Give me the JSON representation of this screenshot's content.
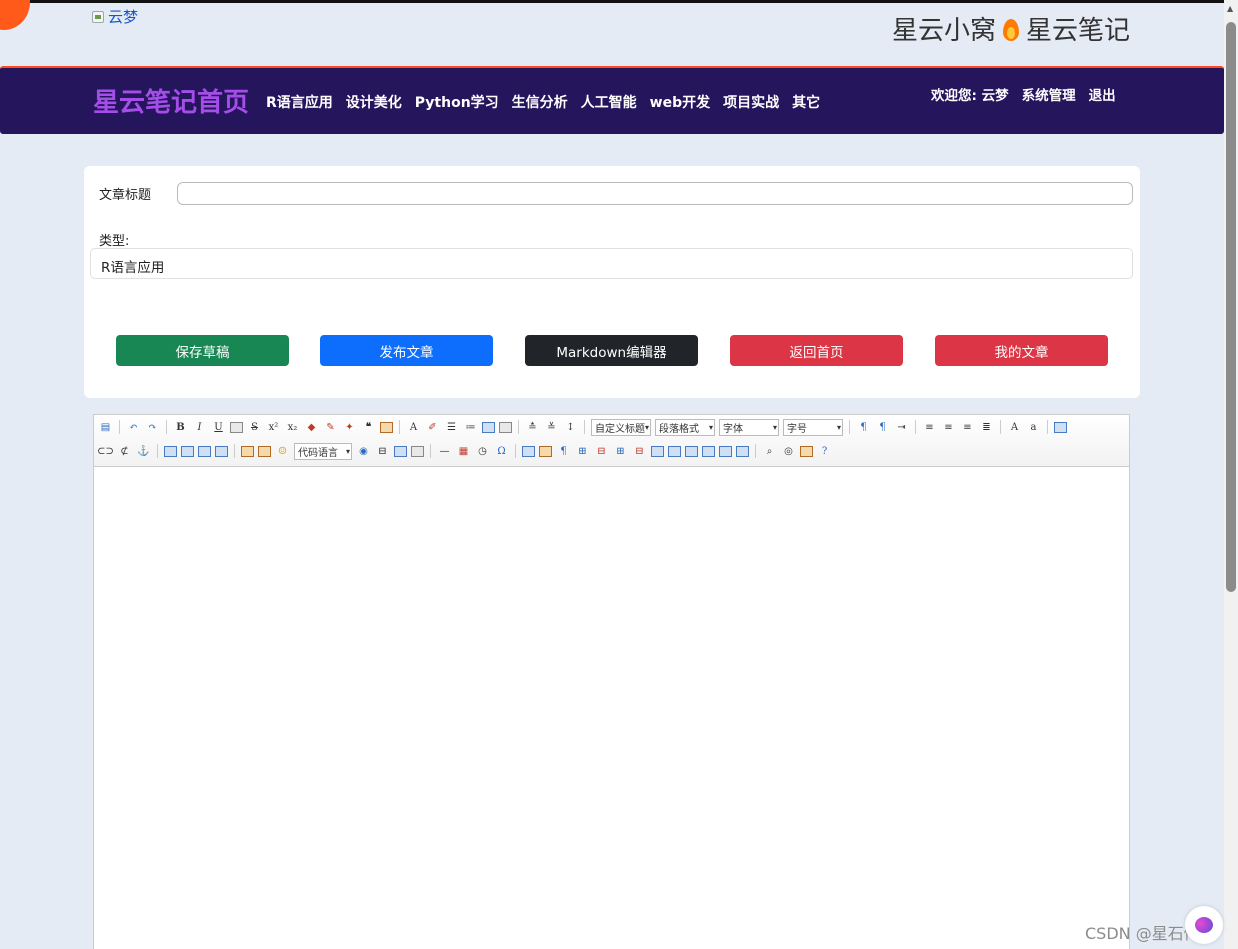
{
  "header": {
    "logo_alt": "云梦",
    "brand_left": "星云小窝",
    "brand_right": "星云笔记"
  },
  "navbar": {
    "title": "星云笔记首页",
    "links": [
      "R语言应用",
      "设计美化",
      "Python学习",
      "生信分析",
      "人工智能",
      "web开发",
      "项目实战",
      "其它"
    ],
    "welcome": "欢迎您: 云梦",
    "admin": "系统管理",
    "logout": "退出"
  },
  "form": {
    "title_label": "文章标题",
    "title_value": "",
    "type_label": "类型:",
    "type_value": "R语言应用"
  },
  "buttons": {
    "save": "保存草稿",
    "publish": "发布文章",
    "markdown": "Markdown编辑器",
    "home": "返回首页",
    "mine": "我的文章"
  },
  "toolbar": {
    "custom_title": "自定义标题",
    "paragraph": "段落格式",
    "font": "字体",
    "size": "字号",
    "code_lang": "代码语言"
  },
  "watermark": "CSDN @星石传说",
  "colors": {
    "navbar_bg": "#25155c",
    "brand_purple": "#a54de8",
    "save": "#198754",
    "publish": "#0d6efd",
    "markdown": "#212529",
    "danger": "#dc3545"
  }
}
